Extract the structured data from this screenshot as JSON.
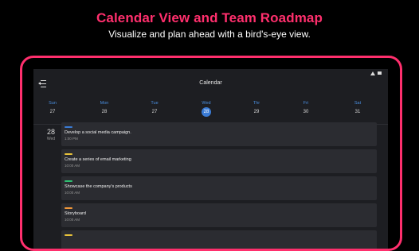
{
  "hero": {
    "title": "Calendar View and Team Roadmap",
    "subtitle": "Visualize and plan ahead with a bird's-eye view."
  },
  "appbar": {
    "title": "Calendar",
    "menu_icon": "collapse-menu-icon"
  },
  "week": [
    {
      "name": "Sun",
      "num": "27"
    },
    {
      "name": "Mon",
      "num": "28"
    },
    {
      "name": "Tue",
      "num": "27"
    },
    {
      "name": "Wed",
      "num": "28",
      "today": true
    },
    {
      "name": "Thr",
      "num": "29"
    },
    {
      "name": "Fri",
      "num": "30"
    },
    {
      "name": "Sat",
      "num": "31"
    }
  ],
  "selected_date": {
    "num": "28",
    "name": "Wed"
  },
  "events": [
    {
      "title": "Develop a social media campaign.",
      "time": "1:00 PM",
      "color": "#3a7bd5"
    },
    {
      "title": "Create a series of email marketing",
      "time": "10:00 AM",
      "color": "#e8c23a"
    },
    {
      "title": "Showcase the company's products",
      "time": "10:00 AM",
      "color": "#2fbf71"
    },
    {
      "title": "Storyboard",
      "time": "10:00 AM",
      "color": "#f0973a"
    },
    {
      "title": "",
      "time": "",
      "color": "#e8c23a"
    }
  ],
  "colors": {
    "accent": "#ff2f6d",
    "today": "#3a7bd5",
    "dayname": "#4a8fe0"
  }
}
